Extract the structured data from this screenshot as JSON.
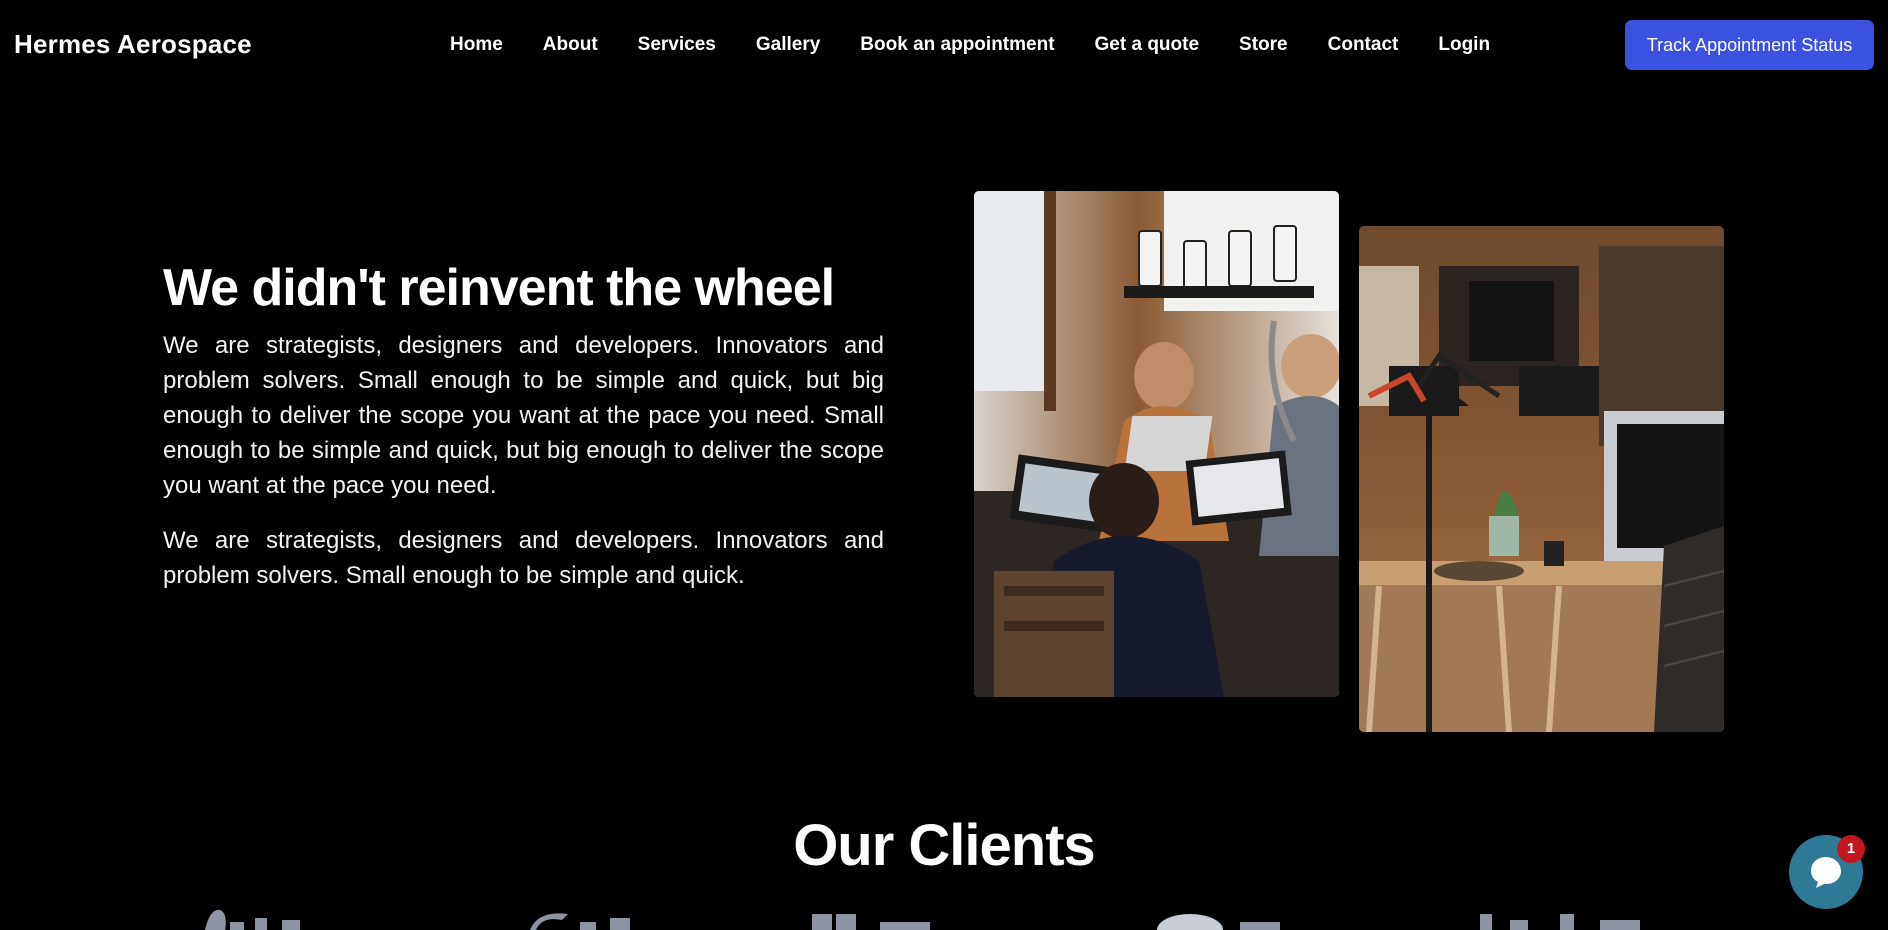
{
  "header": {
    "brand": "Hermes Aerospace",
    "nav": [
      "Home",
      "About",
      "Services",
      "Gallery",
      "Book an appointment",
      "Get a quote",
      "Store",
      "Contact",
      "Login"
    ],
    "cta_label": "Track Appointment Status",
    "cta_color": "#3b52e0"
  },
  "hero": {
    "title": "We didn't reinvent the wheel",
    "paragraph1": "We are strategists, designers and developers. Innovators and problem solvers. Small enough to be simple and quick, but big enough to deliver the scope you want at the pace you need. Small enough to be simple and quick, but big enough to deliver the scope you want at the pace you need.",
    "paragraph2": "We are strategists, designers and developers. Innovators and problem solvers. Small enough to be simple and quick."
  },
  "clients": {
    "title": "Our Clients"
  },
  "chat": {
    "badge_count": "1",
    "color": "#2e7a96",
    "badge_color": "#c0181e"
  }
}
